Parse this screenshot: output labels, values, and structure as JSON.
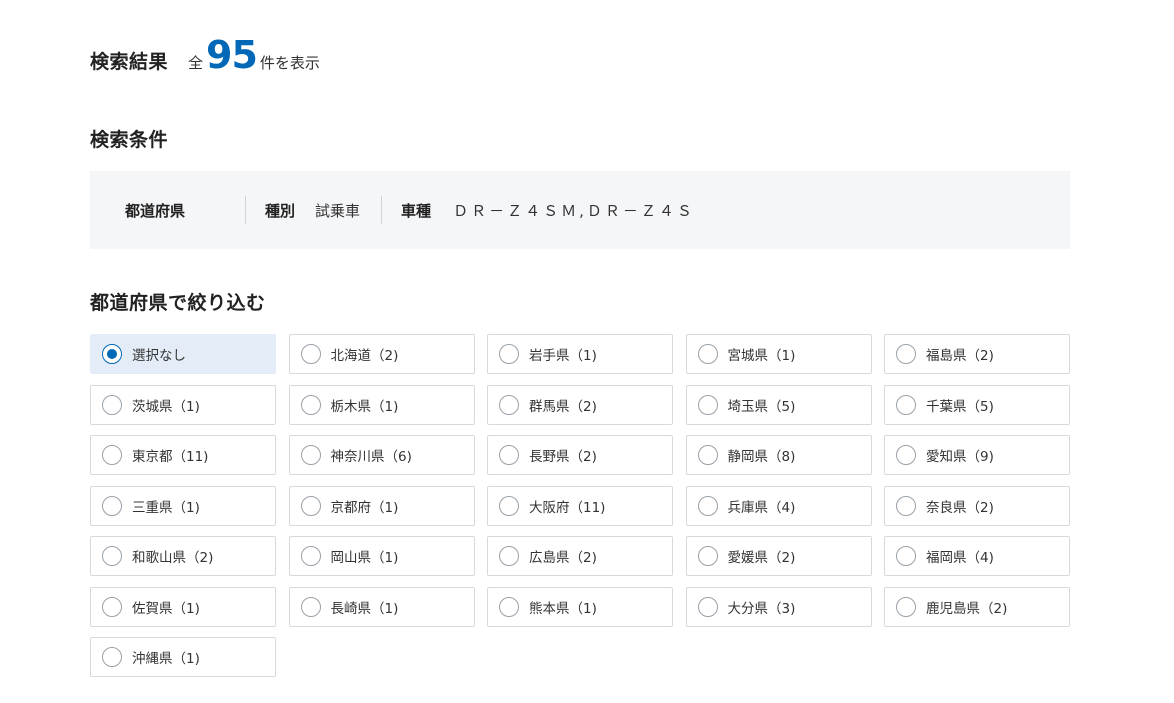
{
  "results": {
    "title": "検索結果",
    "prefix": "全",
    "count": "95",
    "suffix": "件を表示"
  },
  "conditions": {
    "title": "検索条件",
    "items": [
      {
        "label": "都道府県",
        "value": ""
      },
      {
        "label": "種別",
        "value": "試乗車"
      },
      {
        "label": "車種",
        "value": "ＤＲ－Ｚ４ＳＭ,ＤＲ－Ｚ４Ｓ"
      }
    ]
  },
  "filter": {
    "title": "都道府県で絞り込む",
    "accent_color": "#0068b6",
    "options": [
      {
        "label": "選択なし",
        "selected": true
      },
      {
        "label": "北海道（2)",
        "selected": false
      },
      {
        "label": "岩手県（1)",
        "selected": false
      },
      {
        "label": "宮城県（1)",
        "selected": false
      },
      {
        "label": "福島県（2)",
        "selected": false
      },
      {
        "label": "茨城県（1)",
        "selected": false
      },
      {
        "label": "栃木県（1)",
        "selected": false
      },
      {
        "label": "群馬県（2)",
        "selected": false
      },
      {
        "label": "埼玉県（5)",
        "selected": false
      },
      {
        "label": "千葉県（5)",
        "selected": false
      },
      {
        "label": "東京都（11)",
        "selected": false
      },
      {
        "label": "神奈川県（6)",
        "selected": false
      },
      {
        "label": "長野県（2)",
        "selected": false
      },
      {
        "label": "静岡県（8)",
        "selected": false
      },
      {
        "label": "愛知県（9)",
        "selected": false
      },
      {
        "label": "三重県（1)",
        "selected": false
      },
      {
        "label": "京都府（1)",
        "selected": false
      },
      {
        "label": "大阪府（11)",
        "selected": false
      },
      {
        "label": "兵庫県（4)",
        "selected": false
      },
      {
        "label": "奈良県（2)",
        "selected": false
      },
      {
        "label": "和歌山県（2)",
        "selected": false
      },
      {
        "label": "岡山県（1)",
        "selected": false
      },
      {
        "label": "広島県（2)",
        "selected": false
      },
      {
        "label": "愛媛県（2)",
        "selected": false
      },
      {
        "label": "福岡県（4)",
        "selected": false
      },
      {
        "label": "佐賀県（1)",
        "selected": false
      },
      {
        "label": "長崎県（1)",
        "selected": false
      },
      {
        "label": "熊本県（1)",
        "selected": false
      },
      {
        "label": "大分県（3)",
        "selected": false
      },
      {
        "label": "鹿児島県（2)",
        "selected": false
      },
      {
        "label": "沖縄県（1)",
        "selected": false
      }
    ]
  }
}
